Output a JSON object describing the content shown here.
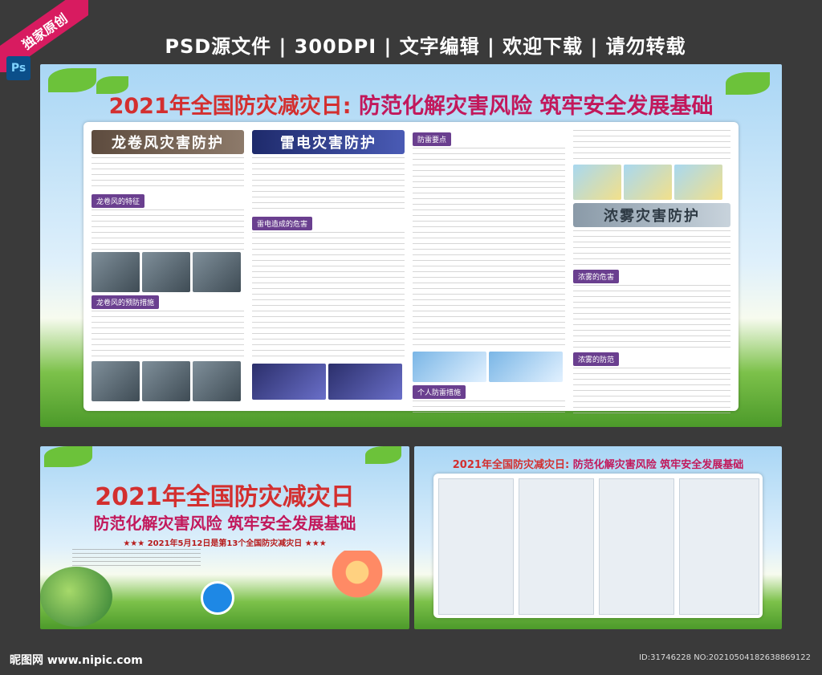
{
  "badge": {
    "corner_label": "独家原创",
    "ps_label": "Ps"
  },
  "banner": {
    "text": "PSD源文件 | 300DPI | 文字编辑 | 欢迎下载 | 请勿转载"
  },
  "panel_main": {
    "title_year": "2021年全国防灾减灾日:",
    "title_slogan": "防范化解灾害风险 筑牢安全发展基础",
    "col1": {
      "header": "龙卷风灾害防护",
      "sub1": "龙卷风的特征",
      "sub2": "龙卷风的预防措施"
    },
    "col2": {
      "header": "雷电灾害防护",
      "sub1": "雷电造成的危害"
    },
    "col3": {
      "sub1": "防雷要点",
      "sub2": "个人防雷措施"
    },
    "col4": {
      "header": "浓雾灾害防护",
      "sub1": "浓雾的危害",
      "sub2": "浓雾的防范"
    }
  },
  "panel_cover": {
    "title": "2021年全国防灾减灾日",
    "subtitle": "防范化解灾害风险 筑牢安全发展基础",
    "date_line": "★★★ 2021年5月12日是第13个全国防灾减灾日 ★★★"
  },
  "panel_preview": {
    "title_year": "2021年全国防灾减灾日:",
    "title_slogan": "防范化解灾害风险 筑牢安全发展基础"
  },
  "footer": {
    "site": "昵图网 www.nipic.com",
    "id": "ID:31746228 NO:20210504182638869122"
  }
}
